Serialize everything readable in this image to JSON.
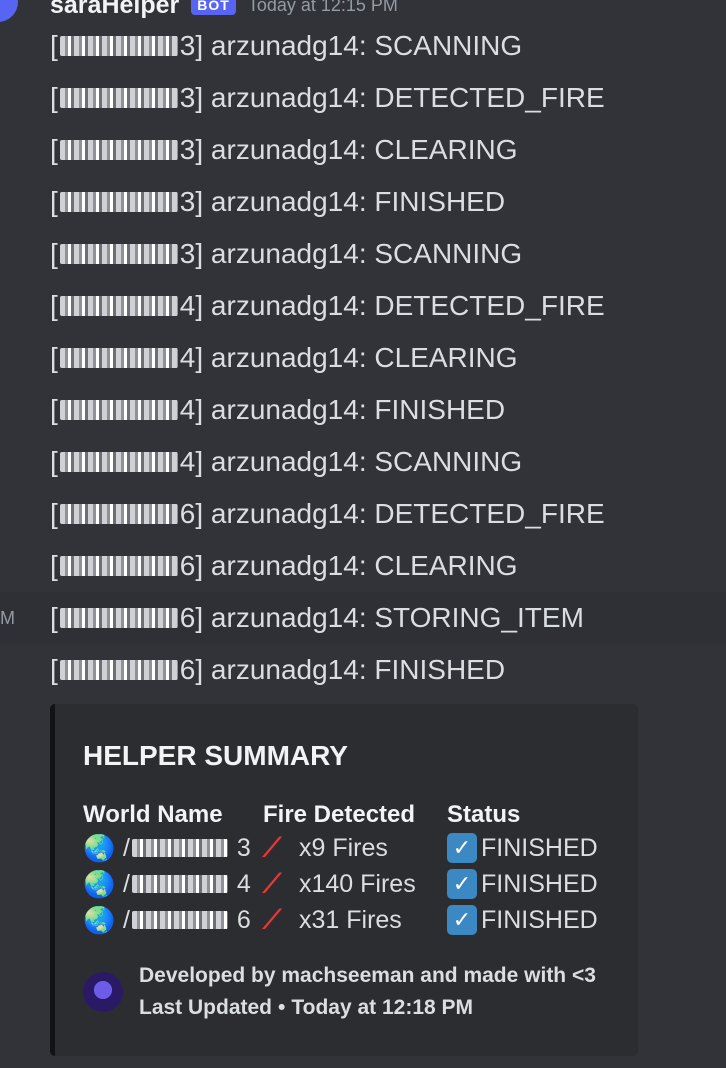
{
  "message": {
    "author": "saraHelper",
    "badge": "BOT",
    "timestamp": "Today at 12:15 PM",
    "hover_time": "M",
    "lines": [
      {
        "suffix": "3]",
        "text": "arzunadg14: SCANNING"
      },
      {
        "suffix": "3]",
        "text": "arzunadg14: DETECTED_FIRE"
      },
      {
        "suffix": "3]",
        "text": "arzunadg14: CLEARING"
      },
      {
        "suffix": "3]",
        "text": "arzunadg14: FINISHED"
      },
      {
        "suffix": "3]",
        "text": "arzunadg14: SCANNING"
      },
      {
        "suffix": "4]",
        "text": "arzunadg14: DETECTED_FIRE"
      },
      {
        "suffix": "4]",
        "text": "arzunadg14: CLEARING"
      },
      {
        "suffix": "4]",
        "text": "arzunadg14: FINISHED"
      },
      {
        "suffix": "4]",
        "text": "arzunadg14: SCANNING"
      },
      {
        "suffix": "6]",
        "text": "arzunadg14: DETECTED_FIRE"
      },
      {
        "suffix": "6]",
        "text": "arzunadg14: CLEARING"
      },
      {
        "suffix": "6]",
        "text": "arzunadg14: STORING_ITEM"
      },
      {
        "suffix": "6]",
        "text": "arzunadg14: FINISHED"
      }
    ]
  },
  "embed": {
    "title": "HELPER SUMMARY",
    "columns": {
      "world": "World Name",
      "fire": "Fire Detected",
      "status": "Status"
    },
    "rows": [
      {
        "world_suffix": "3",
        "fires": "x9 Fires",
        "status": "FINISHED"
      },
      {
        "world_suffix": "4",
        "fires": "x140 Fires",
        "status": "FINISHED"
      },
      {
        "world_suffix": "6",
        "fires": "x31 Fires",
        "status": "FINISHED"
      }
    ],
    "footer": {
      "line1": "Developed by machseeman and made with <3",
      "line2_label": "Last Updated",
      "line2_sep": "•",
      "line2_time": "Today at 12:18 PM"
    },
    "icons": {
      "world": "globe-icon",
      "fire": "fire-extinguisher-icon",
      "status": "check-box-icon"
    }
  },
  "colors": {
    "background": "#313338",
    "embed_background": "#2b2d31",
    "embed_border": "#111214",
    "bot_badge": "#5865f2",
    "check_icon": "#3b88c3"
  }
}
